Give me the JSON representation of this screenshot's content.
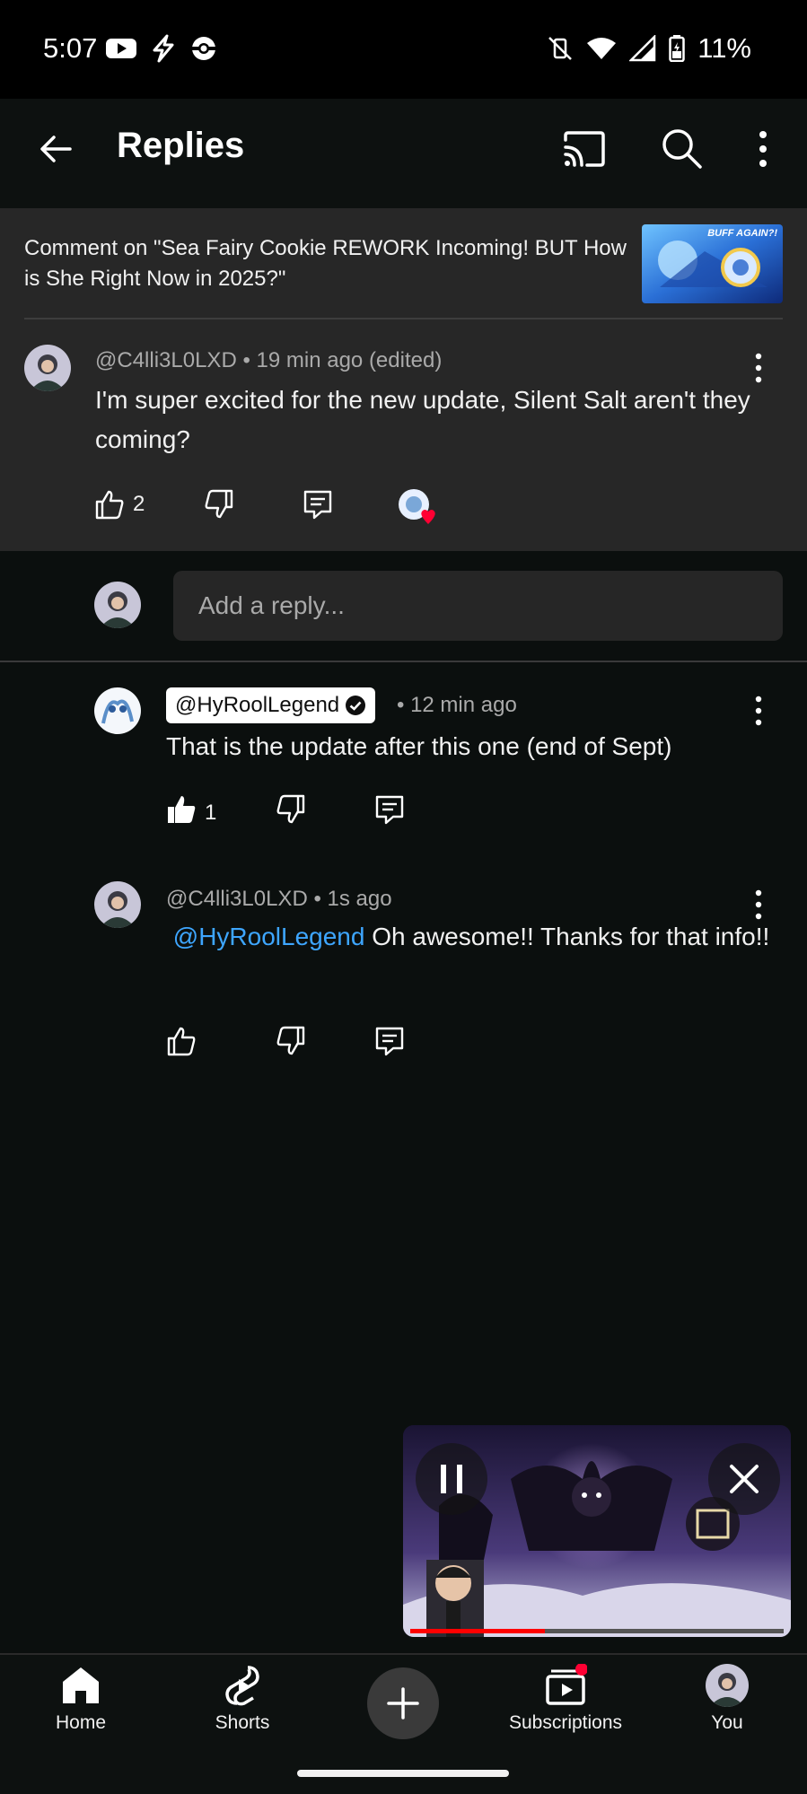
{
  "status_bar": {
    "time": "5:07",
    "battery": "11%"
  },
  "app_bar": {
    "title": "Replies"
  },
  "header": {
    "comment_on": "Comment on \"Sea Fairy Cookie REWORK Incoming! BUT How is She Right Now in 2025?\"",
    "thumbnail_text": "BUFF AGAIN?!"
  },
  "main_comment": {
    "author": "@C4lli3L0LXD",
    "meta": "• 19 min ago (edited)",
    "text": "I'm super excited for the new update, Silent Salt aren't they coming?",
    "likes": "2"
  },
  "reply_box": {
    "placeholder": "Add a reply..."
  },
  "replies": [
    {
      "author": "@HyRoolLegend",
      "verified": true,
      "meta": "• 12 min ago",
      "text": "That is the update after this one (end of Sept)",
      "likes": "1"
    },
    {
      "author": "@C4lli3L0LXD",
      "meta": "• 1s ago",
      "mention": "@HyRoolLegend",
      "text": "Oh awesome!! Thanks for that info!!"
    }
  ],
  "mini_player": {
    "progress_fraction": 0.36
  },
  "bottom_nav": {
    "home": "Home",
    "shorts": "Shorts",
    "subscriptions": "Subscriptions",
    "you": "You"
  },
  "colors": {
    "mention": "#3ea6ff",
    "progress": "#ff0000",
    "heart": "#ff0033",
    "notification_dot": "#ff0033"
  }
}
